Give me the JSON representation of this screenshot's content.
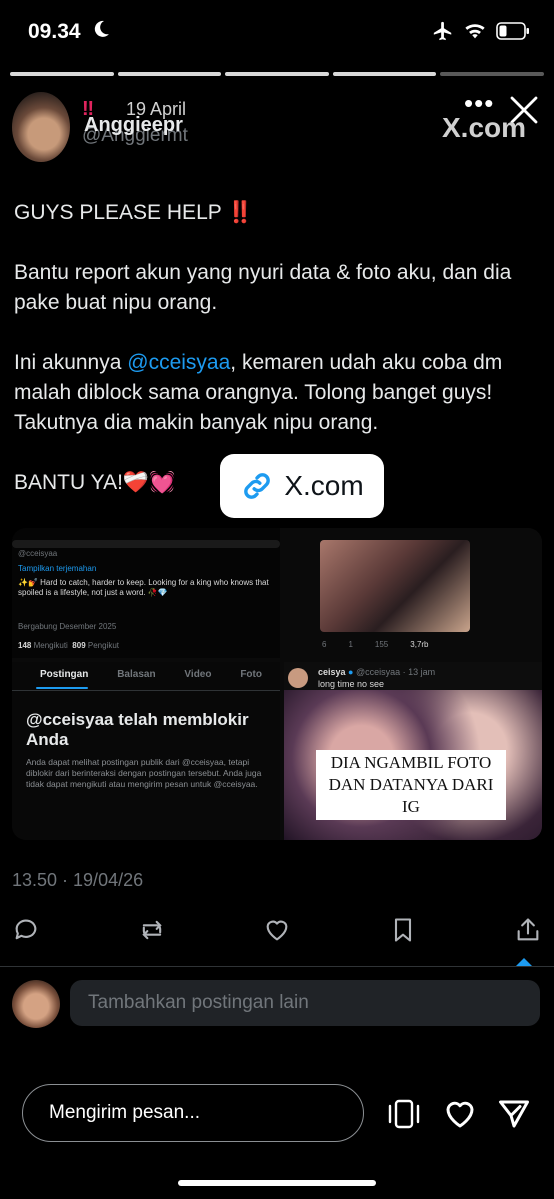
{
  "status_bar": {
    "time": "09.34",
    "icons": [
      "moon-icon",
      "airplane-icon",
      "wifi-icon",
      "battery-icon"
    ]
  },
  "story": {
    "progress_segments": 5,
    "progress_done": 4
  },
  "tweet": {
    "name": "Anggieepr",
    "handle": "@Anggiermt",
    "badge": "‼",
    "date": "19 April",
    "source_label": "X.com",
    "line1": "GUYS PLEASE HELP",
    "line1_emoji": "‼️",
    "para2": "Bantu report akun yang nyuri data & foto aku, dan dia pake buat nipu orang.",
    "para3_before": "Ini akunnya ",
    "para3_mention": "@cceisyaa",
    "para3_after": ", kemaren udah aku coba dm malah diblock sama orangnya. Tolong banget guys! Takutnya dia makin banyak nipu orang.",
    "line4": "BANTU YA!",
    "line4_emoji": "❤️‍🩹💓",
    "pill_label": "X.com",
    "meta": "13.50 · 19/04/26"
  },
  "media": {
    "profile": {
      "handle": "@cceisyaa",
      "translate": "Tampilkan terjemahan",
      "bio": "✨💅 Hard to catch, harder to keep. Looking for a king who knows that spoiled is a lifestyle, not just a word. 🥀💎",
      "joined": "Bergabung Desember 2025",
      "following_count": "148",
      "following_label": "Mengikuti",
      "followers_count": "809",
      "followers_label": "Pengikut"
    },
    "tabs": [
      "Postingan",
      "Balasan",
      "Video",
      "Foto"
    ],
    "block": {
      "title": "@cceisyaa telah memblokir Anda",
      "desc": "Anda dapat melihat postingan publik dari @cceisyaa, tetapi diblokir dari berinteraksi dengan postingan tersebut. Anda juga tidak dapat mengikuti atau mengirim pesan untuk @cceisyaa."
    },
    "post_stats": {
      "replies": "6",
      "reposts": "1",
      "likes": "155",
      "views": "3,7rb"
    },
    "quoted": {
      "name": "ceisya",
      "handle": "@cceisyaa · 13 jam",
      "text": "long time no see",
      "caption": "DIA NGAMBIL FOTO DAN DATANYA DARI IG"
    }
  },
  "reply": {
    "placeholder": "Tambahkan postingan lain"
  },
  "bottom": {
    "message_placeholder": "Mengirim pesan..."
  },
  "colors": {
    "accent": "#1d9bf0",
    "muted": "#71767b",
    "background": "#000000"
  }
}
